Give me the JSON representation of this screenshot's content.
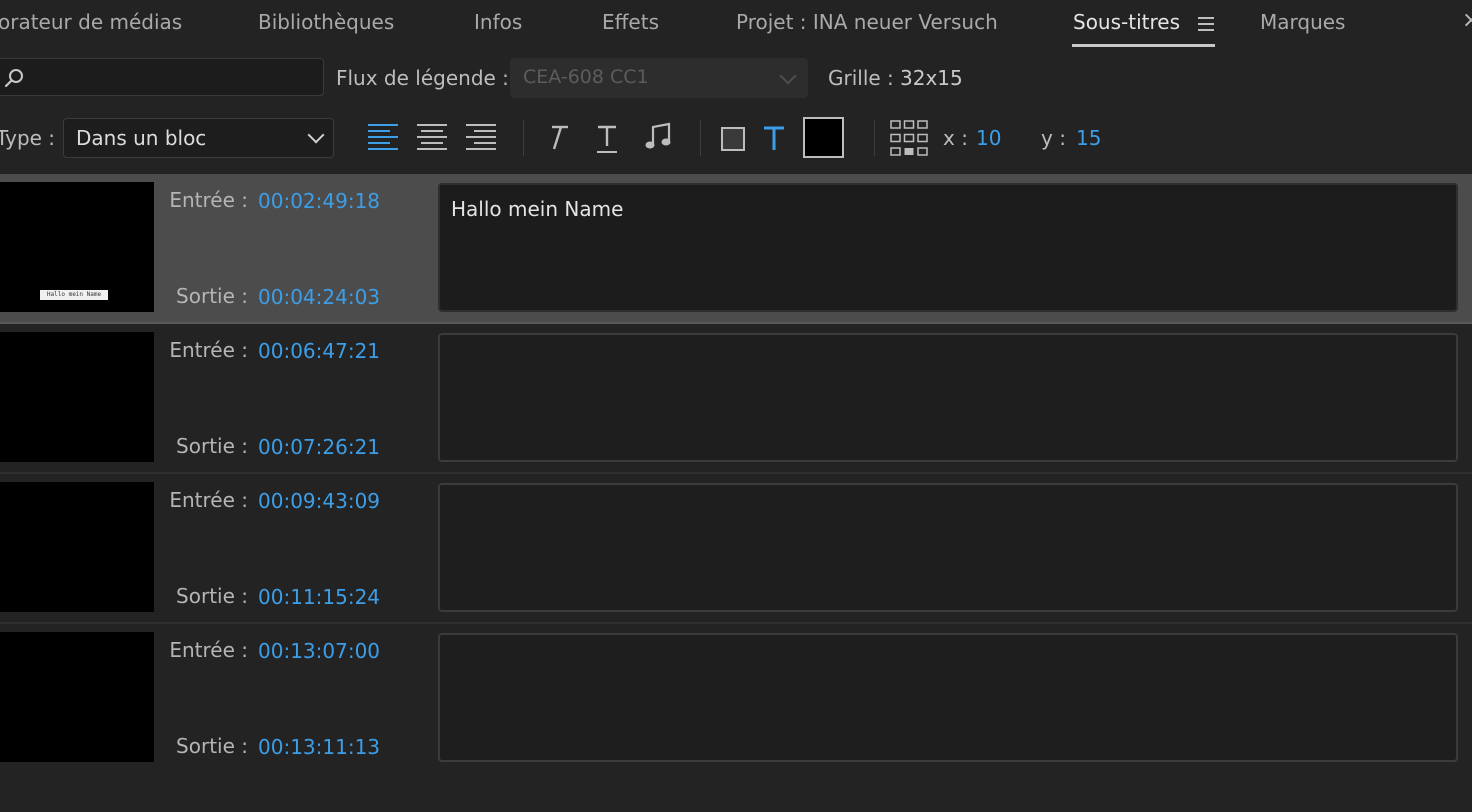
{
  "tabs": [
    {
      "label": "orateur de médias"
    },
    {
      "label": "Bibliothèques"
    },
    {
      "label": "Infos"
    },
    {
      "label": "Effets"
    },
    {
      "label": "Projet : INA neuer Versuch"
    },
    {
      "label": "Sous-titres",
      "active": true
    },
    {
      "label": "Marques"
    }
  ],
  "toolbar": {
    "search_value": "",
    "stream_label": "Flux de légende :",
    "stream_value": "CEA-608 CC1",
    "grid_label": "Grille :",
    "grid_value": "32x15",
    "type_label": "Type :",
    "type_value": "Dans un bloc",
    "x_label": "x :",
    "x_value": "10",
    "y_label": "y :",
    "y_value": "15",
    "text_color": "#000000"
  },
  "captions": [
    {
      "in_label": "Entrée :",
      "in": "00:02:49:18",
      "out_label": "Sortie :",
      "out": "00:04:24:03",
      "text": "Hallo mein Name",
      "thumb_text": "Hallo mein Name",
      "selected": true
    },
    {
      "in_label": "Entrée :",
      "in": "00:06:47:21",
      "out_label": "Sortie :",
      "out": "00:07:26:21",
      "text": ""
    },
    {
      "in_label": "Entrée :",
      "in": "00:09:43:09",
      "out_label": "Sortie :",
      "out": "00:11:15:24",
      "text": ""
    },
    {
      "in_label": "Entrée :",
      "in": "00:13:07:00",
      "out_label": "Sortie :",
      "out": "00:13:11:13",
      "text": ""
    }
  ],
  "colors": {
    "accent": "#3d9ee8",
    "background": "#232323",
    "selected_row": "#4c4c4c"
  }
}
